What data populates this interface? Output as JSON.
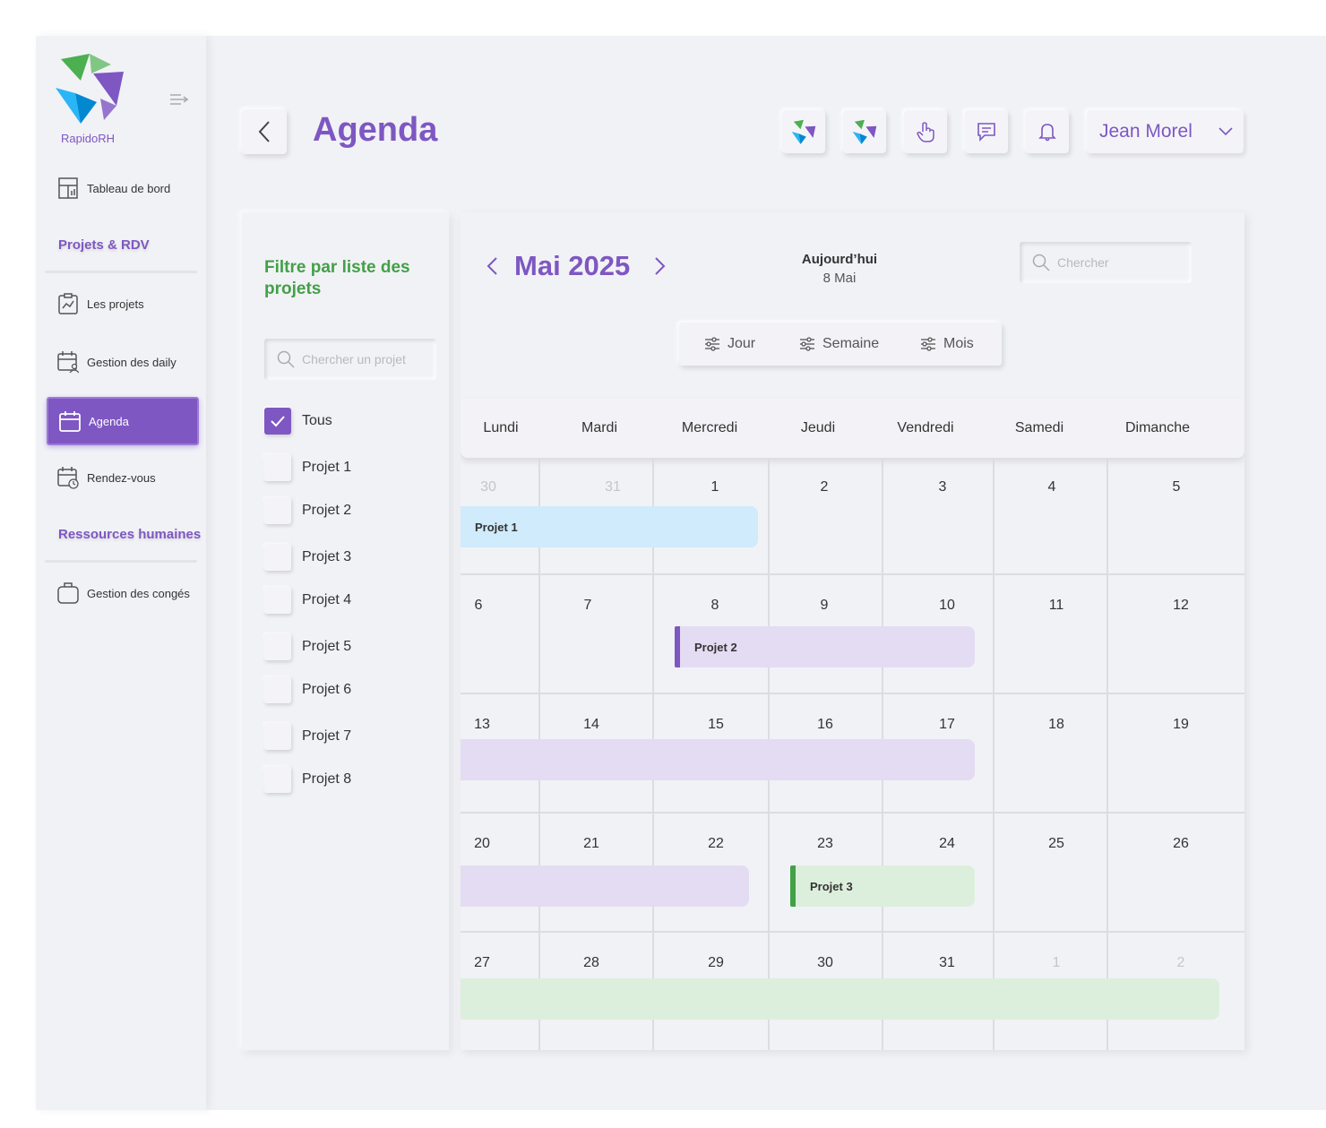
{
  "brand": {
    "name": "RapidoRH"
  },
  "sidebar": {
    "items": [
      {
        "label": "Tableau de bord",
        "icon": "dashboard-icon"
      },
      {
        "label": "Les projets",
        "icon": "clipboard-chart-icon"
      },
      {
        "label": "Gestion des daily",
        "icon": "calendar-user-icon"
      },
      {
        "label": "Agenda",
        "icon": "calendar-icon"
      },
      {
        "label": "Rendez-vous",
        "icon": "calendar-clock-icon"
      },
      {
        "label": "Gestion des congés",
        "icon": "bag-icon"
      }
    ],
    "sections": [
      "Projets & RDV",
      "Ressources humaines"
    ]
  },
  "header": {
    "title": "Agenda",
    "user": "Jean Morel",
    "icons": [
      "app-logo-icon",
      "app-logo-icon",
      "hand-pointer-icon",
      "message-icon",
      "bell-icon"
    ]
  },
  "filter": {
    "title": "Filtre par liste des projets",
    "search_placeholder": "Chercher  un projet",
    "options": [
      {
        "label": "Tous",
        "checked": true
      },
      {
        "label": "Projet 1",
        "checked": false
      },
      {
        "label": "Projet 2",
        "checked": false
      },
      {
        "label": "Projet 3",
        "checked": false
      },
      {
        "label": "Projet 4",
        "checked": false
      },
      {
        "label": "Projet 5",
        "checked": false
      },
      {
        "label": "Projet 6",
        "checked": false
      },
      {
        "label": "Projet 7",
        "checked": false
      },
      {
        "label": "Projet 8",
        "checked": false
      }
    ]
  },
  "calendar": {
    "month": "Mai 2025",
    "today_label": "Aujourd’hui",
    "today_date": "8 Mai",
    "search_placeholder": "Chercher",
    "views": [
      "Jour",
      "Semaine",
      "Mois"
    ],
    "weekdays": [
      "Lundi",
      "Mardi",
      "Mercredi",
      "Jeudi",
      "Vendredi",
      "Samedi",
      "Dimanche"
    ],
    "weeks": [
      [
        "30",
        "31",
        "1",
        "2",
        "3",
        "4",
        "5"
      ],
      [
        "6",
        "7",
        "8",
        "9",
        "10",
        "11",
        "12"
      ],
      [
        "13",
        "14",
        "15",
        "16",
        "17",
        "18",
        "19"
      ],
      [
        "20",
        "21",
        "22",
        "23",
        "24",
        "25",
        "26"
      ],
      [
        "27",
        "28",
        "29",
        "30",
        "31",
        "1",
        "2"
      ]
    ],
    "events": [
      {
        "label": "Projet 1",
        "color": "#d0ebfb"
      },
      {
        "label": "Projet 2",
        "color": "#e4dcf2",
        "accent": "#7e57c2"
      },
      {
        "label": "",
        "color": "#e4dcf2"
      },
      {
        "label": "",
        "color": "#e4dcf2"
      },
      {
        "label": "Projet 3",
        "color": "#dcefdc",
        "accent": "#43a047"
      },
      {
        "label": "",
        "color": "#dcefdc"
      }
    ]
  },
  "colors": {
    "accent": "#7e57c2",
    "green": "#43a047",
    "background": "#f1f2f6"
  }
}
